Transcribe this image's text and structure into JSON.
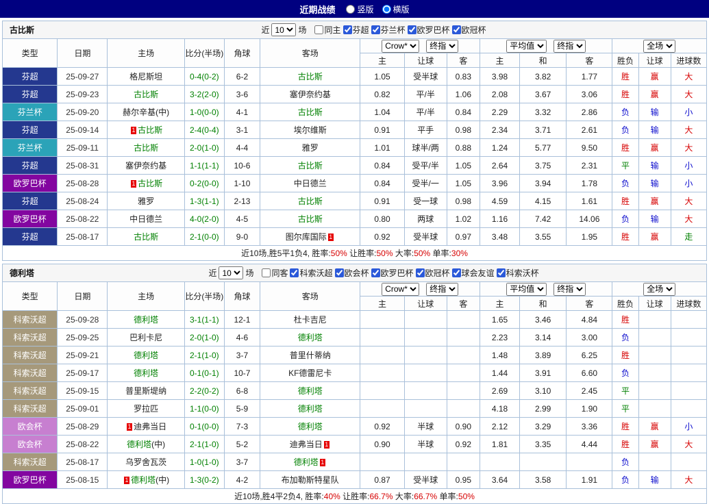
{
  "topbar": {
    "title": "近期战绩",
    "views": [
      {
        "label": "竖版",
        "selected": false
      },
      {
        "label": "横版",
        "selected": true
      }
    ]
  },
  "filter_near": "近",
  "filter_games": "场",
  "table_header": {
    "type": "类型",
    "date": "日期",
    "home": "主场",
    "score": "比分(半场)",
    "corners": "角球",
    "away": "客场",
    "bookmaker": "Crow*",
    "final1": "终指",
    "average": "平均值",
    "final2": "终指",
    "scope": "全场",
    "odds_cols": [
      "主",
      "让球",
      "客"
    ],
    "avg_cols": [
      "主",
      "和",
      "客"
    ],
    "result_cols": [
      "胜负",
      "让球",
      "进球数"
    ]
  },
  "colors": {
    "topbar": "#000080",
    "grid": "#a9c0da",
    "focus": "#008000",
    "score": "#008000",
    "win": "#d60000",
    "lose": "#0b0bcd",
    "push": "#008000",
    "card": "#e60000",
    "summary_value": "#d60000",
    "league_badge_text": "#ffffff"
  },
  "league_colors": {
    "芬超": "#24388f",
    "芬兰杯": "#2ba3b8",
    "欧罗巴杯": "#8306a0",
    "科索沃超": "#a6997b",
    "欧会杯": "#c77fd0"
  },
  "sections": [
    {
      "team": "古比斯",
      "filter": {
        "count": "10",
        "same": {
          "label": "同主",
          "checked": false
        },
        "leagues": [
          {
            "label": "芬超",
            "checked": true
          },
          {
            "label": "芬兰杯",
            "checked": true
          },
          {
            "label": "欧罗巴杯",
            "checked": true
          },
          {
            "label": "欧冠杯",
            "checked": true
          }
        ]
      },
      "rows": [
        {
          "league": "芬超",
          "date": "25-09-27",
          "home": {
            "name": "格尼斯坦"
          },
          "score": "0-4(0-2)",
          "corners": "6-2",
          "away": {
            "name": "古比斯",
            "focus": true
          },
          "odds": [
            "1.05",
            "受半球",
            "0.83"
          ],
          "avg": [
            "3.98",
            "3.82",
            "1.77"
          ],
          "result": [
            "胜",
            "赢",
            "大"
          ]
        },
        {
          "league": "芬超",
          "date": "25-09-23",
          "home": {
            "name": "古比斯",
            "focus": true
          },
          "score": "3-2(2-0)",
          "corners": "3-6",
          "away": {
            "name": "塞伊奈约基"
          },
          "odds": [
            "0.82",
            "平/半",
            "1.06"
          ],
          "avg": [
            "2.08",
            "3.67",
            "3.06"
          ],
          "result": [
            "胜",
            "赢",
            "大"
          ]
        },
        {
          "league": "芬兰杯",
          "date": "25-09-20",
          "home": {
            "name": "赫尔辛基",
            "suffix": "(中)"
          },
          "score": "1-0(0-0)",
          "corners": "4-1",
          "away": {
            "name": "古比斯",
            "focus": true
          },
          "odds": [
            "1.04",
            "平/半",
            "0.84"
          ],
          "avg": [
            "2.29",
            "3.32",
            "2.86"
          ],
          "result": [
            "负",
            "输",
            "小"
          ]
        },
        {
          "league": "芬超",
          "date": "25-09-14",
          "home": {
            "name": "古比斯",
            "focus": true,
            "card": "before"
          },
          "score": "2-4(0-4)",
          "corners": "3-1",
          "away": {
            "name": "埃尔维斯"
          },
          "odds": [
            "0.91",
            "平手",
            "0.98"
          ],
          "avg": [
            "2.34",
            "3.71",
            "2.61"
          ],
          "result": [
            "负",
            "输",
            "大"
          ]
        },
        {
          "league": "芬兰杯",
          "date": "25-09-11",
          "home": {
            "name": "古比斯",
            "focus": true
          },
          "score": "2-0(1-0)",
          "corners": "4-4",
          "away": {
            "name": "雅罗"
          },
          "odds": [
            "1.01",
            "球半/两",
            "0.88"
          ],
          "avg": [
            "1.24",
            "5.77",
            "9.50"
          ],
          "result": [
            "胜",
            "赢",
            "大"
          ]
        },
        {
          "league": "芬超",
          "date": "25-08-31",
          "home": {
            "name": "塞伊奈约基"
          },
          "score": "1-1(1-1)",
          "corners": "10-6",
          "away": {
            "name": "古比斯",
            "focus": true
          },
          "odds": [
            "0.84",
            "受平/半",
            "1.05"
          ],
          "avg": [
            "2.64",
            "3.75",
            "2.31"
          ],
          "result": [
            "平",
            "输",
            "小"
          ]
        },
        {
          "league": "欧罗巴杯",
          "date": "25-08-28",
          "home": {
            "name": "古比斯",
            "focus": true,
            "card": "before"
          },
          "score": "0-2(0-0)",
          "corners": "1-10",
          "away": {
            "name": "中日德兰"
          },
          "odds": [
            "0.84",
            "受半/一",
            "1.05"
          ],
          "avg": [
            "3.96",
            "3.94",
            "1.78"
          ],
          "result": [
            "负",
            "输",
            "小"
          ]
        },
        {
          "league": "芬超",
          "date": "25-08-24",
          "home": {
            "name": "雅罗"
          },
          "score": "1-3(1-1)",
          "corners": "2-13",
          "away": {
            "name": "古比斯",
            "focus": true
          },
          "odds": [
            "0.91",
            "受一球",
            "0.98"
          ],
          "avg": [
            "4.59",
            "4.15",
            "1.61"
          ],
          "result": [
            "胜",
            "赢",
            "大"
          ]
        },
        {
          "league": "欧罗巴杯",
          "date": "25-08-22",
          "home": {
            "name": "中日德兰"
          },
          "score": "4-0(2-0)",
          "corners": "4-5",
          "away": {
            "name": "古比斯",
            "focus": true
          },
          "odds": [
            "0.80",
            "两球",
            "1.02"
          ],
          "avg": [
            "1.16",
            "7.42",
            "14.06"
          ],
          "result": [
            "负",
            "输",
            "大"
          ]
        },
        {
          "league": "芬超",
          "date": "25-08-17",
          "home": {
            "name": "古比斯",
            "focus": true
          },
          "score": "2-1(0-0)",
          "corners": "9-0",
          "away": {
            "name": "图尔库国际",
            "card": "after"
          },
          "odds": [
            "0.92",
            "受半球",
            "0.97"
          ],
          "avg": [
            "3.48",
            "3.55",
            "1.95"
          ],
          "result": [
            "胜",
            "赢",
            "走"
          ]
        }
      ],
      "summary": [
        {
          "text": "近10场,胜5平1负4, 胜率:",
          "red": false
        },
        {
          "text": "50%",
          "red": true
        },
        {
          "text": " 让胜率:",
          "red": false
        },
        {
          "text": "50%",
          "red": true
        },
        {
          "text": " 大率:",
          "red": false
        },
        {
          "text": "50%",
          "red": true
        },
        {
          "text": " 单率:",
          "red": false
        },
        {
          "text": "30%",
          "red": true
        }
      ]
    },
    {
      "team": "德利塔",
      "filter": {
        "count": "10",
        "same": {
          "label": "同客",
          "checked": false
        },
        "leagues": [
          {
            "label": "科索沃超",
            "checked": true
          },
          {
            "label": "欧会杯",
            "checked": true
          },
          {
            "label": "欧罗巴杯",
            "checked": true
          },
          {
            "label": "欧冠杯",
            "checked": true
          },
          {
            "label": "球会友谊",
            "checked": true
          },
          {
            "label": "科索沃杯",
            "checked": true
          }
        ]
      },
      "rows": [
        {
          "league": "科索沃超",
          "date": "25-09-28",
          "home": {
            "name": "德利塔",
            "focus": true
          },
          "score": "3-1(1-1)",
          "corners": "12-1",
          "away": {
            "name": "杜卡吉尼"
          },
          "odds": [
            "",
            "",
            ""
          ],
          "avg": [
            "1.65",
            "3.46",
            "4.84"
          ],
          "result": [
            "胜",
            "",
            ""
          ]
        },
        {
          "league": "科索沃超",
          "date": "25-09-25",
          "home": {
            "name": "巴利卡尼"
          },
          "score": "2-0(1-0)",
          "corners": "4-6",
          "away": {
            "name": "德利塔",
            "focus": true
          },
          "odds": [
            "",
            "",
            ""
          ],
          "avg": [
            "2.23",
            "3.14",
            "3.00"
          ],
          "result": [
            "负",
            "",
            ""
          ]
        },
        {
          "league": "科索沃超",
          "date": "25-09-21",
          "home": {
            "name": "德利塔",
            "focus": true
          },
          "score": "2-1(1-0)",
          "corners": "3-7",
          "away": {
            "name": "普里什蒂纳"
          },
          "odds": [
            "",
            "",
            ""
          ],
          "avg": [
            "1.48",
            "3.89",
            "6.25"
          ],
          "result": [
            "胜",
            "",
            ""
          ]
        },
        {
          "league": "科索沃超",
          "date": "25-09-17",
          "home": {
            "name": "德利塔",
            "focus": true
          },
          "score": "0-1(0-1)",
          "corners": "10-7",
          "away": {
            "name": "KF德雷尼卡"
          },
          "odds": [
            "",
            "",
            ""
          ],
          "avg": [
            "1.44",
            "3.91",
            "6.60"
          ],
          "result": [
            "负",
            "",
            ""
          ]
        },
        {
          "league": "科索沃超",
          "date": "25-09-15",
          "home": {
            "name": "普里斯堤纳"
          },
          "score": "2-2(0-2)",
          "corners": "6-8",
          "away": {
            "name": "德利塔",
            "focus": true
          },
          "odds": [
            "",
            "",
            ""
          ],
          "avg": [
            "2.69",
            "3.10",
            "2.45"
          ],
          "result": [
            "平",
            "",
            ""
          ]
        },
        {
          "league": "科索沃超",
          "date": "25-09-01",
          "home": {
            "name": "罗拉匹"
          },
          "score": "1-1(0-0)",
          "corners": "5-9",
          "away": {
            "name": "德利塔",
            "focus": true
          },
          "odds": [
            "",
            "",
            ""
          ],
          "avg": [
            "4.18",
            "2.99",
            "1.90"
          ],
          "result": [
            "平",
            "",
            ""
          ]
        },
        {
          "league": "欧会杯",
          "date": "25-08-29",
          "home": {
            "name": "迪弗当日",
            "card": "before"
          },
          "score": "0-1(0-0)",
          "corners": "7-3",
          "away": {
            "name": "德利塔",
            "focus": true
          },
          "odds": [
            "0.92",
            "半球",
            "0.90"
          ],
          "avg": [
            "2.12",
            "3.29",
            "3.36"
          ],
          "result": [
            "胜",
            "赢",
            "小"
          ]
        },
        {
          "league": "欧会杯",
          "date": "25-08-22",
          "home": {
            "name": "德利塔",
            "focus": true,
            "suffix": "(中)"
          },
          "score": "2-1(1-0)",
          "corners": "5-2",
          "away": {
            "name": "迪弗当日",
            "card": "after"
          },
          "odds": [
            "0.90",
            "半球",
            "0.92"
          ],
          "avg": [
            "1.81",
            "3.35",
            "4.44"
          ],
          "result": [
            "胜",
            "赢",
            "大"
          ]
        },
        {
          "league": "科索沃超",
          "date": "25-08-17",
          "home": {
            "name": "乌罗舍瓦茨"
          },
          "score": "1-0(1-0)",
          "corners": "3-7",
          "away": {
            "name": "德利塔",
            "focus": true,
            "card": "after"
          },
          "odds": [
            "",
            "",
            ""
          ],
          "avg": [
            "",
            "",
            ""
          ],
          "result": [
            "负",
            "",
            ""
          ]
        },
        {
          "league": "欧罗巴杯",
          "date": "25-08-15",
          "home": {
            "name": "德利塔",
            "focus": true,
            "suffix": "(中)",
            "card": "before"
          },
          "score": "1-3(0-2)",
          "corners": "4-2",
          "away": {
            "name": "布加勒斯特星队"
          },
          "odds": [
            "0.87",
            "受半球",
            "0.95"
          ],
          "avg": [
            "3.64",
            "3.58",
            "1.91"
          ],
          "result": [
            "负",
            "输",
            "大"
          ]
        }
      ],
      "summary": [
        {
          "text": "近10场,胜4平2负4, 胜率:",
          "red": false
        },
        {
          "text": "40%",
          "red": true
        },
        {
          "text": " 让胜率:",
          "red": false
        },
        {
          "text": "66.7%",
          "red": true
        },
        {
          "text": " 大率:",
          "red": false
        },
        {
          "text": "66.7%",
          "red": true
        },
        {
          "text": " 单率:",
          "red": false
        },
        {
          "text": "50%",
          "red": true
        }
      ]
    }
  ]
}
